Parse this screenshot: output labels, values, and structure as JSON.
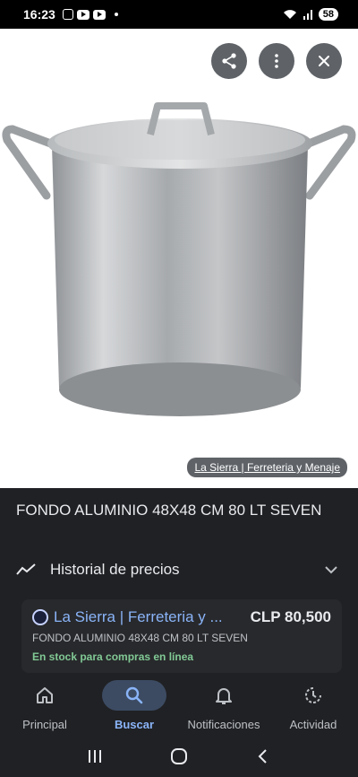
{
  "status_bar": {
    "time": "16:23",
    "battery": "58"
  },
  "image_viewer": {
    "source_link": "La Sierra | Ferreteria y Menaje",
    "share_icon": "share-icon",
    "more_icon": "more-vert-icon",
    "close_icon": "close-icon"
  },
  "product": {
    "title": "FONDO ALUMINIO 48X48 CM 80 LT SEVEN",
    "price_history_label": "Historial de precios"
  },
  "offer": {
    "store": "La Sierra | Ferreteria y ...",
    "price": "CLP 80,500",
    "description": "FONDO ALUMINIO 48X48 CM 80 LT SEVEN",
    "stock": "En stock para compras en línea"
  },
  "bottom_nav": {
    "items": [
      {
        "label": "Principal",
        "icon": "home-icon"
      },
      {
        "label": "Buscar",
        "icon": "search-icon",
        "active": true
      },
      {
        "label": "Notificaciones",
        "icon": "bell-icon"
      },
      {
        "label": "Actividad",
        "icon": "activity-icon"
      }
    ]
  },
  "colors": {
    "accent": "#8ab4f8",
    "stock_green": "#81c995",
    "background": "#202124"
  }
}
